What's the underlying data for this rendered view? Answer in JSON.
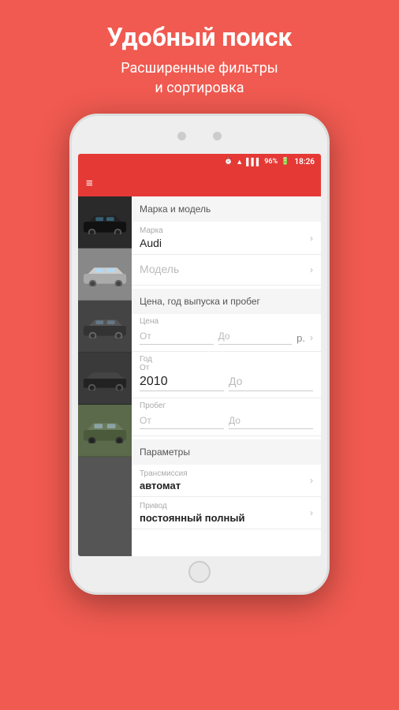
{
  "background_color": "#f05a50",
  "header": {
    "title": "Удобный поиск",
    "subtitle": "Расширенные фильтры\nи сортировка"
  },
  "status_bar": {
    "time": "18:26",
    "battery": "96%",
    "signal_icon": "📶"
  },
  "filter": {
    "section_brand_model": "Марка и модель",
    "brand_label": "Марка",
    "brand_value": "Audi",
    "model_label": "Модель",
    "model_placeholder": "Модель",
    "section_price_year": "Цена, год выпуска и пробег",
    "price_label": "Цена",
    "price_from_label": "От",
    "price_to_label": "До",
    "price_currency": "р.",
    "year_label": "Год",
    "year_from_label": "От",
    "year_from_value": "2010",
    "year_to_label": "До",
    "mileage_label": "Пробег",
    "mileage_from_label": "От",
    "mileage_to_label": "До",
    "section_params": "Параметры",
    "transmission_label": "Трансмиссия",
    "transmission_value": "автомат",
    "drive_label": "Привод",
    "drive_value": "постоянный полный"
  },
  "car_colors": [
    "#3a3a3a",
    "#555",
    "#777",
    "#444",
    "#666",
    "#333"
  ]
}
